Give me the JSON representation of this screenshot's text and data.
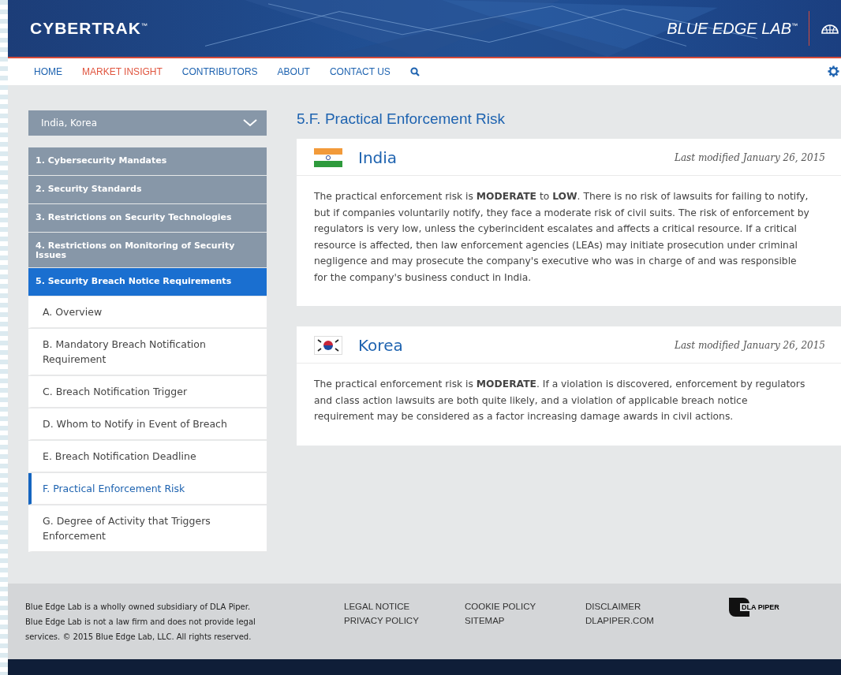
{
  "header": {
    "brand": "CYBERTRAK",
    "brand_mark": "™",
    "lab": "BLUE EDGE LAB",
    "lab_mark": "™"
  },
  "nav": [
    {
      "label": "HOME",
      "selected": false
    },
    {
      "label": "MARKET INSIGHT",
      "selected": true
    },
    {
      "label": "CONTRIBUTORS",
      "selected": false
    },
    {
      "label": "ABOUT",
      "selected": false
    },
    {
      "label": "CONTACT US",
      "selected": false
    }
  ],
  "sidebar": {
    "country_select": "India, Korea",
    "sections": [
      {
        "label": "1. Cybersecurity Mandates",
        "selected": false
      },
      {
        "label": "2. Security Standards",
        "selected": false
      },
      {
        "label": "3. Restrictions on Security Technologies",
        "selected": false
      },
      {
        "label": "4. Restrictions on Monitoring of Security Issues",
        "selected": false
      },
      {
        "label": "5. Security Breach Notice Requirements",
        "selected": true,
        "children": [
          {
            "label": "A. Overview",
            "selected": false
          },
          {
            "label": "B. Mandatory Breach Notification Requirement",
            "selected": false
          },
          {
            "label": "C. Breach Notification Trigger",
            "selected": false
          },
          {
            "label": "D. Whom to Notify in Event of Breach",
            "selected": false
          },
          {
            "label": "E. Breach Notification Deadline",
            "selected": false
          },
          {
            "label": "F. Practical Enforcement Risk",
            "selected": true
          },
          {
            "label": "G. Degree of Activity that Triggers Enforcement",
            "selected": false
          }
        ]
      }
    ]
  },
  "page_title": "5.F. Practical Enforcement Risk",
  "cards": [
    {
      "country": "India",
      "kind": "india",
      "modified": "Last modified January 26, 2015",
      "text": "The practical enforcement risk is **MODERATE** to **LOW**. There is no risk of lawsuits for failing to notify, but if companies voluntarily notify, they face a moderate risk of civil suits. The risk of enforcement by regulators is very low, unless the cyberincident escalates and affects a critical resource. If a critical resource is affected, then law enforcement agencies (LEAs) may initiate prosecution under criminal negligence and may prosecute the company's executive who was in charge of and was responsible for the company's business conduct in India."
    },
    {
      "country": "Korea",
      "kind": "korea",
      "modified": "Last modified January 26, 2015",
      "text": "The practical enforcement risk is **MODERATE**. If a violation is discovered, enforcement by regulators and class action lawsuits are both quite likely, and a violation of applicable breach notice requirement may be considered as a factor increasing damage awards in civil actions."
    }
  ],
  "footer": {
    "about": [
      "Blue Edge Lab is a wholly owned subsidiary of DLA Piper.",
      "Blue Edge Lab is not a law firm and does not provide legal",
      "services. © 2015 Blue Edge Lab, LLC. All rights reserved."
    ],
    "link_columns": [
      [
        "LEGAL NOTICE",
        "PRIVACY POLICY"
      ],
      [
        "COOKIE POLICY",
        "SITEMAP"
      ],
      [
        "DISCLAIMER",
        "DLAPIPER.COM"
      ]
    ],
    "logo": "DLA PIPER"
  }
}
